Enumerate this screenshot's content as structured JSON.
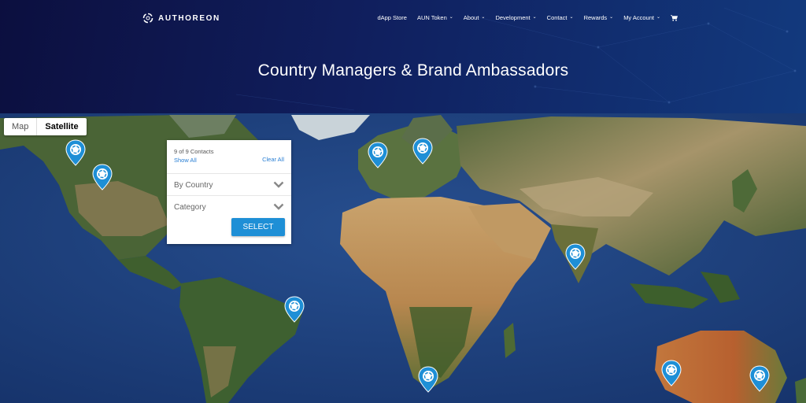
{
  "header": {
    "logo_text": "AUTHOREON",
    "nav": [
      {
        "label": "dApp Store",
        "dropdown": false
      },
      {
        "label": "AUN Token",
        "dropdown": true
      },
      {
        "label": "About",
        "dropdown": true
      },
      {
        "label": "Development",
        "dropdown": true
      },
      {
        "label": "Contact",
        "dropdown": true
      },
      {
        "label": "Rewards",
        "dropdown": true
      },
      {
        "label": "My Account",
        "dropdown": true
      }
    ],
    "title": "Country Managers & Brand Ambassadors"
  },
  "map": {
    "type_buttons": {
      "map": "Map",
      "satellite": "Satellite"
    },
    "active_type": "Satellite",
    "panel": {
      "count": "9 of 9 Contacts",
      "show_all": "Show All",
      "clear_all": "Clear All",
      "filter_country": "By Country",
      "filter_category": "Category",
      "select_label": "SELECT"
    },
    "pin_color": "#1e8fd6"
  }
}
